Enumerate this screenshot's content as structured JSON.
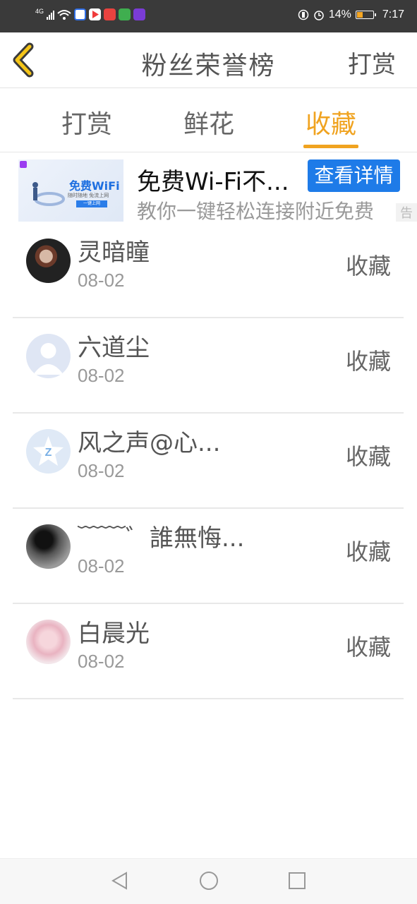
{
  "status_bar": {
    "network": "4G",
    "battery_text": "14%",
    "battery_level": 0.14,
    "time": "7:17"
  },
  "header": {
    "title": "粉丝荣誉榜",
    "action": "打赏"
  },
  "tabs": [
    {
      "label": "打赏",
      "active": false
    },
    {
      "label": "鲜花",
      "active": false
    },
    {
      "label": "收藏",
      "active": true
    }
  ],
  "ad": {
    "title": "免费Wi-Fi不...",
    "description": "教你一键轻松连接附近免费",
    "button": "查看详情",
    "tag": "告",
    "thumb": {
      "title": "免费WiFi",
      "subtitle": "随时随地 免流上网",
      "button": "一键上网"
    }
  },
  "fans": [
    {
      "name": "灵暗瞳",
      "date": "08-02",
      "action": "收藏"
    },
    {
      "name": "六道尘",
      "date": "08-02",
      "action": "收藏"
    },
    {
      "name": "风之声@心...",
      "date": "08-02",
      "action": "收藏"
    },
    {
      "name": "﹋﹋゛誰無悔...",
      "date": "08-02",
      "action": "收藏"
    },
    {
      "name": "白晨光",
      "date": "08-02",
      "action": "收藏"
    }
  ],
  "colors": {
    "accent": "#f0a320",
    "ad_button": "#1e7be8"
  }
}
